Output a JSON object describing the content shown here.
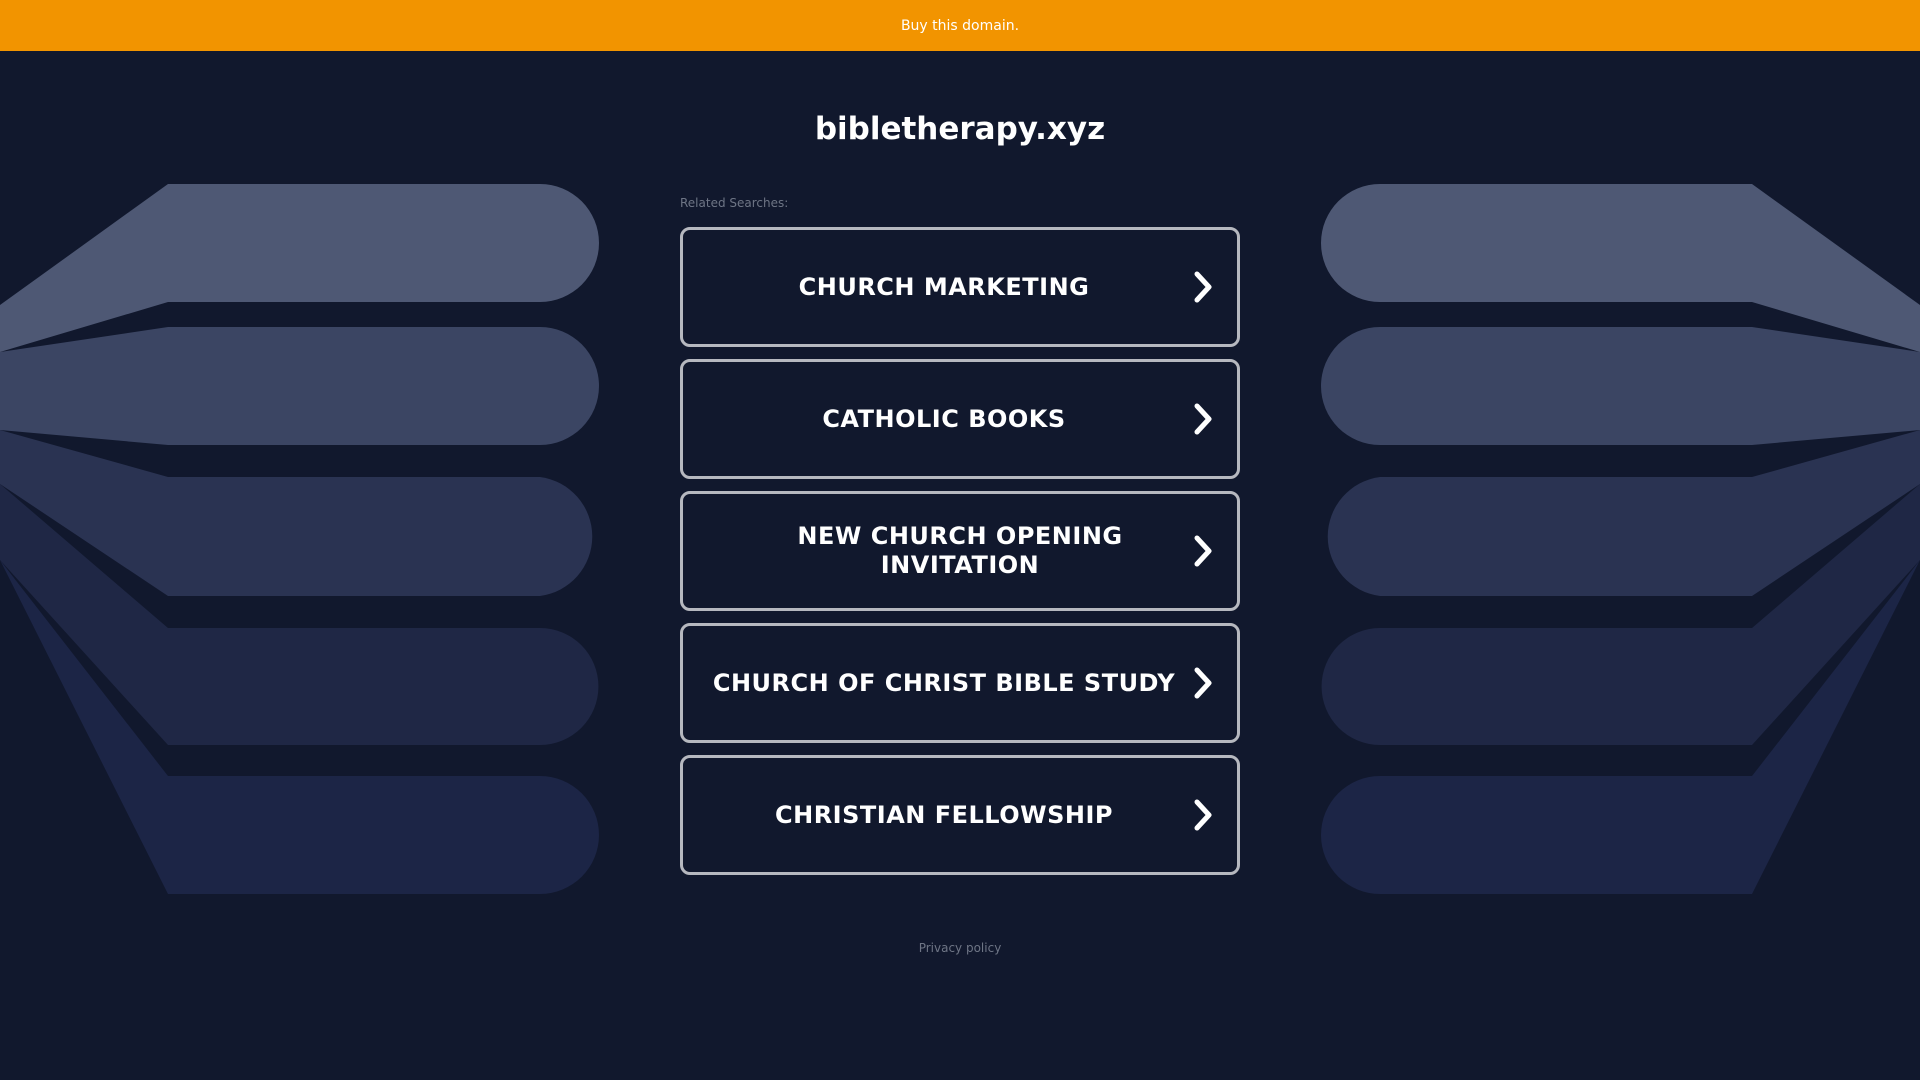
{
  "banner": {
    "link_label": "Buy this domain.",
    "background": "#f29400"
  },
  "page": {
    "domain_title": "bibletherapy.xyz",
    "background": "#11182d"
  },
  "related": {
    "label": "Related Searches:",
    "items": [
      {
        "label": "CHURCH MARKETING",
        "icon": "chevron-right-icon"
      },
      {
        "label": "CATHOLIC BOOKS",
        "icon": "chevron-right-icon"
      },
      {
        "label": "NEW CHURCH OPENING INVITATION",
        "icon": "chevron-right-icon"
      },
      {
        "label": "CHURCH OF CHRIST BIBLE STUDY",
        "icon": "chevron-right-icon"
      },
      {
        "label": "CHRISTIAN FELLOWSHIP",
        "icon": "chevron-right-icon"
      }
    ]
  },
  "footer": {
    "privacy_label": "Privacy policy"
  },
  "colors": {
    "stripe_1": "#4e5874",
    "stripe_2": "#3b4563",
    "stripe_3": "#2a3352",
    "stripe_4": "#1f2745",
    "stripe_5": "#1c2546",
    "button_border": "#b6b8bf"
  }
}
